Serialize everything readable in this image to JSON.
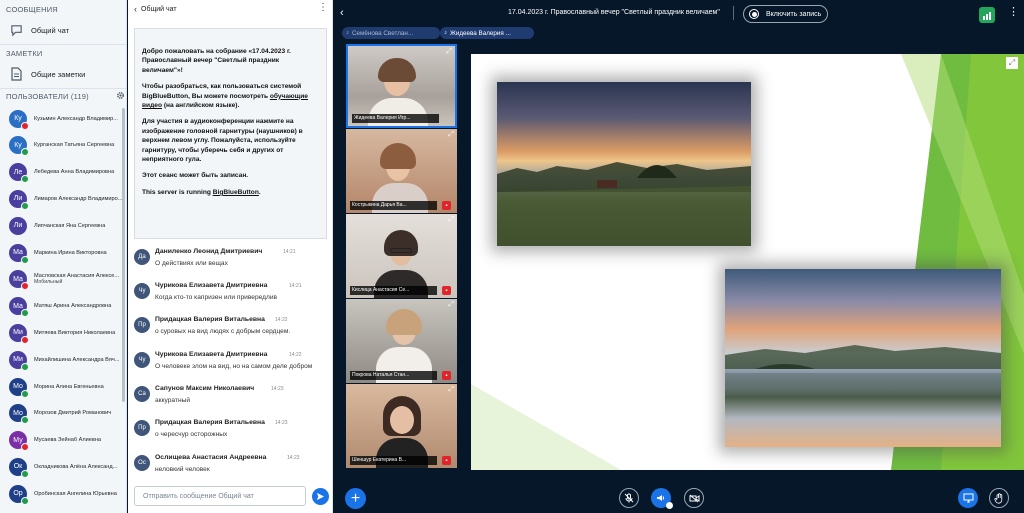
{
  "sidebar": {
    "messages_title": "СООБЩЕНИЯ",
    "public_chat": "Общий чат",
    "notes_title": "ЗАМЕТКИ",
    "shared_notes": "Общие заметки",
    "users_title": "ПОЛЬЗОВАТЕЛИ (119)",
    "users": [
      {
        "initials": "Ку",
        "name": "Кузьмин Александр Владимир...",
        "color": "#2a6fc4",
        "status": "#e0242a"
      },
      {
        "initials": "Ку",
        "name": "Курганская Татьяна Сергеевна",
        "color": "#2a6fc4",
        "status": "#1f9c4a"
      },
      {
        "initials": "Ле",
        "name": "Лебедева Анна Владимировна",
        "color": "#4a3f9e",
        "status": "#1f9c4a"
      },
      {
        "initials": "Ли",
        "name": "Лимаров Александр Владимиро...",
        "color": "#4a3f9e",
        "status": "#1f9c4a"
      },
      {
        "initials": "Ли",
        "name": "Липчанская Яна Сергеевна",
        "color": "#4a3f9e",
        "status": ""
      },
      {
        "initials": "Ма",
        "name": "Маркина Ирина Викторовна",
        "color": "#4a3f9e",
        "status": "#1f9c4a"
      },
      {
        "initials": "Ма",
        "name": "Масловская Анастасия Алексе...",
        "sub": "Мобильный",
        "color": "#4a3f9e",
        "status": "#e0242a"
      },
      {
        "initials": "Ма",
        "name": "Матяш Арина Александровна",
        "color": "#4a3f9e",
        "status": "#1f9c4a"
      },
      {
        "initials": "Ми",
        "name": "Митяева Виктория Николаевна",
        "color": "#4a3f9e",
        "status": "#e0242a"
      },
      {
        "initials": "Ми",
        "name": "Михайлишина Александра Вяч...",
        "color": "#4a3f9e",
        "status": "#1f9c4a"
      },
      {
        "initials": "Мо",
        "name": "Морина Алина Евгеньевна",
        "color": "#1f3f88",
        "status": "#1f9c4a"
      },
      {
        "initials": "Мо",
        "name": "Морозов Дмитрий Романович",
        "color": "#1f3f88",
        "status": "#1f9c4a"
      },
      {
        "initials": "Му",
        "name": "Мусаева Зейнаб Алиевна",
        "color": "#7a2fa6",
        "status": "#e0242a"
      },
      {
        "initials": "Ок",
        "name": "Окладникова Алёна Александ...",
        "color": "#1f3f88",
        "status": "#1f9c4a"
      },
      {
        "initials": "Ор",
        "name": "Оробинская Ангелина Юрьевна",
        "color": "#1f3f88",
        "status": "#1f9c4a"
      }
    ]
  },
  "chat": {
    "title": "Общий чат",
    "welcome": {
      "p1_prefix": "Добро пожаловать на собрание «",
      "p1_title": "17.04.2023 г. Православный вечер \"Светлый праздник величаем\"",
      "p1_suffix": "»!",
      "p2_a": "Чтобы разобраться, как пользоваться системой BigBlueButton, Вы можете посмотреть ",
      "p2_link": "обучающие видео",
      "p2_b": " (на английском языке).",
      "p3_a": "Для участия в аудиоконференции нажмите на изображение головной гарнитуры (наушников) в верхнем левом углу. ",
      "p3_b": "Пожалуйста, используйте гарнитуру, чтобы уберечь себя и других от неприятного гула.",
      "p4": "Этот сеанс может быть записан.",
      "p5_a": "This server is running ",
      "p5_link": "BigBlueButton",
      "p5_b": "."
    },
    "messages": [
      {
        "initials": "Да",
        "name": "Даниленко Леонид Дмитриевич",
        "time": "14:21",
        "text": "О действиях или вещах"
      },
      {
        "initials": "Чу",
        "name": "Чурикова Елизавета Дмитриевна",
        "time": "14:21",
        "text": "Когда кто-то капризен или привередлив"
      },
      {
        "initials": "Пр",
        "name": "Придацкая Валерия Витальевна",
        "time": "14:22",
        "text": "о суровых на вид людях с добрым сердцем."
      },
      {
        "initials": "Чу",
        "name": "Чурикова Елизавета Дмитриевна",
        "time": "14:22",
        "text": "О человеке злом на вид, но на самом деле добром"
      },
      {
        "initials": "Са",
        "name": "Сапунов Максим Николаевич",
        "time": "14:23",
        "text": "аккуратный"
      },
      {
        "initials": "Пр",
        "name": "Придацкая Валерия Витальевна",
        "time": "14:23",
        "text": "о чересчур осторожных"
      },
      {
        "initials": "Ос",
        "name": "Ослищева Анастасия Андреевна",
        "time": "14:23",
        "text": "неловкий человек"
      }
    ],
    "input_placeholder": "Отправить сообщение Общий чат"
  },
  "topbar": {
    "meeting_title": "17.04.2023 г. Православный вечер \"Светлый праздник величаем\"",
    "record_label": "Включить запись",
    "talker1": "Семёнова Светлан...",
    "talker2": "Жидеева Валерия ..."
  },
  "videos": [
    {
      "name": "Жидеева Валерия Игр...",
      "muted": false
    },
    {
      "name": "Кострыкина Дарья Ва...",
      "muted": true
    },
    {
      "name": "Кислица Анастасия Се...",
      "muted": true
    },
    {
      "name": "Покрова Наталья Стан...",
      "muted": true
    },
    {
      "name": "Шеншур Екатерина В...",
      "muted": true
    }
  ],
  "colors": {
    "accent": "#1b73e8",
    "background": "#06172a",
    "muted_red": "#e0242a",
    "online_green": "#1f9c4a",
    "slide_green": "#5fb52b"
  },
  "icons": {
    "chat": "chat-icon",
    "notes": "notes-icon",
    "settings": "gear-icon",
    "send": "send-icon",
    "back": "chevron-left-icon",
    "record": "record-icon",
    "connection": "signal-icon",
    "options": "kebab-icon",
    "plus": "plus-icon",
    "mic": "microphone-muted-icon",
    "audio": "speaker-icon",
    "video": "camera-off-icon",
    "screen": "screen-share-icon",
    "hand": "raise-hand-icon",
    "fullscreen": "fullscreen-icon"
  }
}
